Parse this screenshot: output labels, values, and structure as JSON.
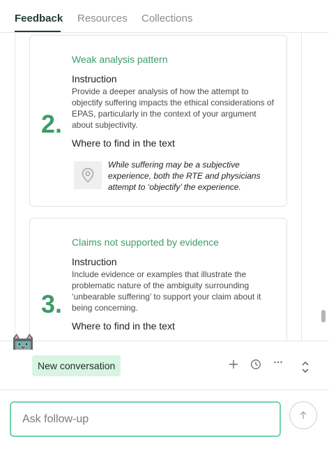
{
  "tabs": [
    {
      "label": "Feedback",
      "active": true
    },
    {
      "label": "Resources",
      "active": false
    },
    {
      "label": "Collections",
      "active": false
    }
  ],
  "feedback_items": [
    {
      "number": "2.",
      "title": "Weak analysis pattern",
      "instruction_heading": "Instruction",
      "instruction_text": "Provide a deeper analysis of how the attempt to objectify suffering impacts the ethical considerations of EPAS, particularly in the context of your argument about subjectivity.",
      "where_heading": "Where to find in the text",
      "quote": "While suffering may be a subjective experience, both the RTE and physicians attempt to ‘objectify’ the experience."
    },
    {
      "number": "3.",
      "title": "Claims not supported by evidence",
      "instruction_heading": "Instruction",
      "instruction_text": "Include evidence or examples that illustrate the problematic nature of the ambiguity surrounding ‘unbearable suffering’ to support your claim about it being concerning.",
      "where_heading": "Where to find in the text"
    }
  ],
  "chat": {
    "new_conversation_label": "New conversation",
    "input_placeholder": "Ask follow-up",
    "icons": [
      "plus-icon",
      "history-icon",
      "more-icon",
      "expand-icon",
      "send-arrow-icon"
    ]
  },
  "colors": {
    "accent_green": "#3c9c6a",
    "pill_bg": "#d7f5e2",
    "input_border": "#6fd3a4",
    "tab_active": "#1f3b35"
  }
}
